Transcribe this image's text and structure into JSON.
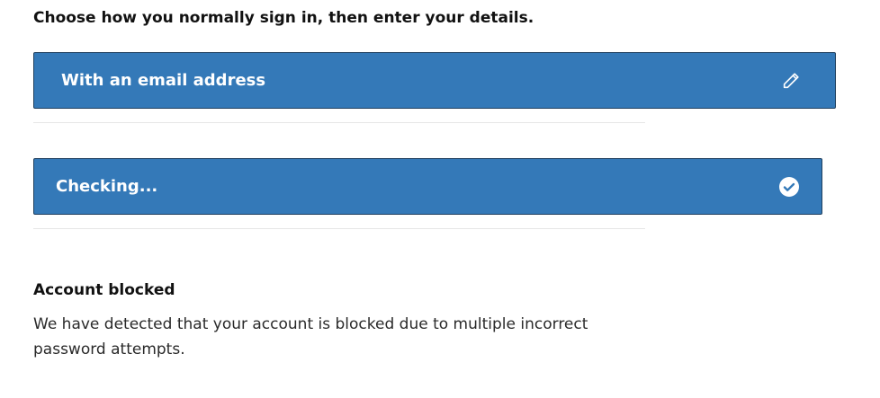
{
  "heading": "Choose how you normally sign in, then enter your details.",
  "options": [
    {
      "label": "With an email address",
      "icon": "pencil-icon"
    },
    {
      "label": "Checking...",
      "icon": "check-circle-icon"
    }
  ],
  "alert": {
    "title": "Account blocked",
    "message": "We have detected that your account is blocked due to multiple incorrect password attempts."
  },
  "colors": {
    "option_background": "#3479b8",
    "option_border": "#1f3f5e",
    "option_text": "#ffffff",
    "divider": "#e6e6e6"
  }
}
